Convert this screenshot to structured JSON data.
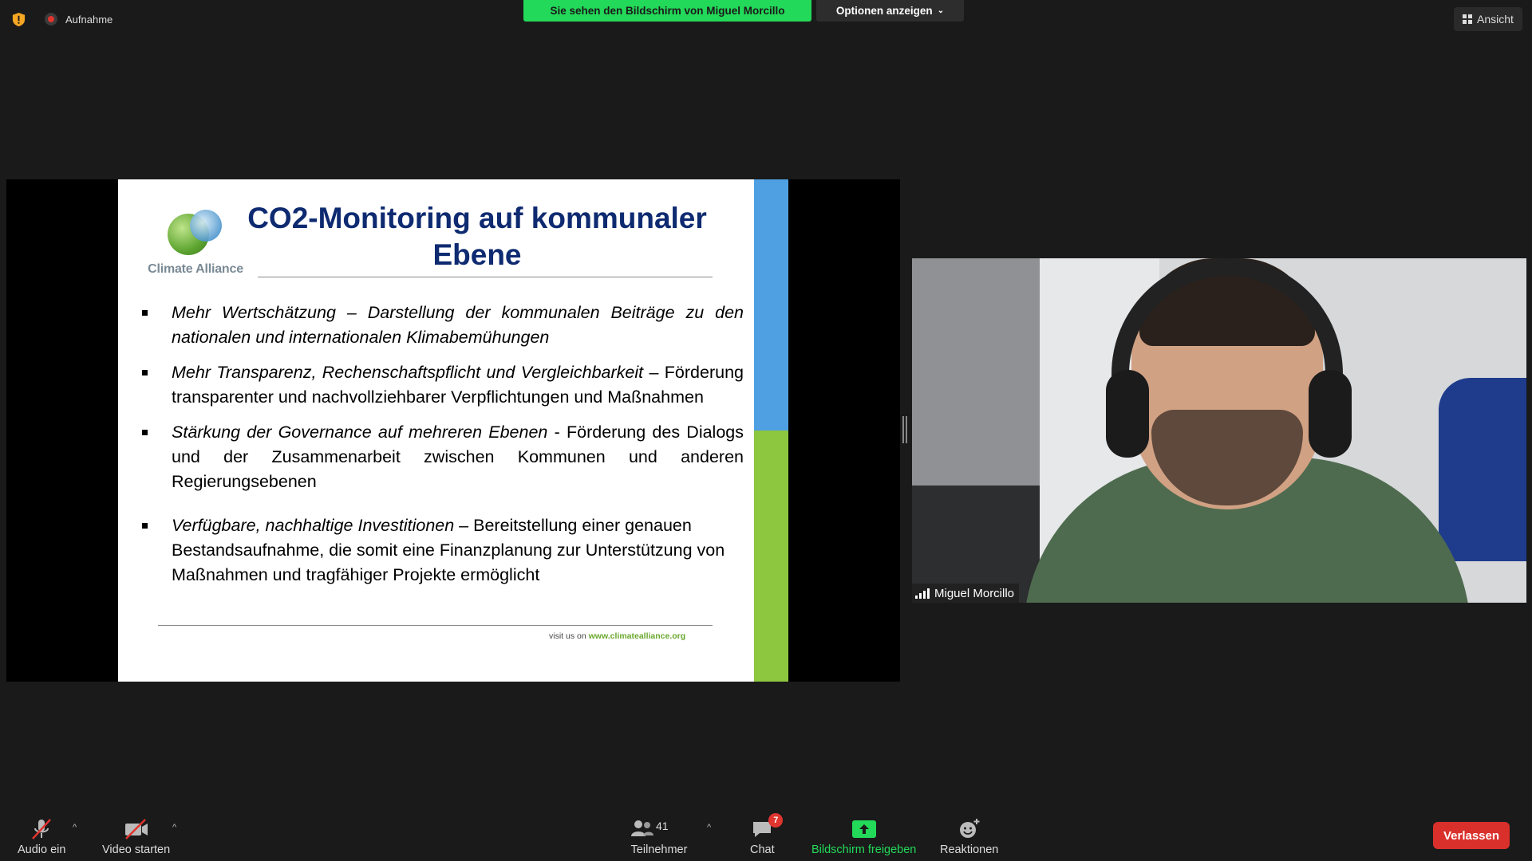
{
  "topbar": {
    "recording_label": "Aufnahme",
    "share_banner": "Sie sehen den Bildschirm von Miguel Morcillo",
    "options_label": "Optionen anzeigen",
    "view_label": "Ansicht"
  },
  "slide": {
    "logo_text": "Climate Alliance",
    "title": "CO2-Monitoring auf kommunaler Ebene",
    "bullets": [
      {
        "lead": "Mehr Wertschätzung – Darstellung der kommunalen Beiträge zu den nationalen und internationalen Klimabemühungen",
        "rest": ""
      },
      {
        "lead": "Mehr Transparenz, Rechenschaftspflicht und Vergleichbarkeit",
        "rest": " – Förderung transparenter und nachvollziehbarer Verpflichtungen und Maßnahmen"
      },
      {
        "lead": "Stärkung der Governance auf mehreren Ebenen",
        "rest": " - Förderung des Dialogs und der Zusammenarbeit zwischen Kommunen und anderen Regierungsebenen"
      },
      {
        "lead": "Verfügbare, nachhaltige Investitionen",
        "rest": " – Bereitstellung einer genauen Bestandsaufnahme, die somit eine Finanzplanung zur Unterstützung von Maßnahmen und tragfähiger Projekte ermöglicht"
      }
    ],
    "footer_prefix": "visit us on",
    "footer_url": "www.climatealliance.org"
  },
  "video": {
    "participant_name": "Miguel Morcillo"
  },
  "toolbar": {
    "audio_label": "Audio ein",
    "video_label": "Video starten",
    "participants_label": "Teilnehmer",
    "participants_count": "41",
    "chat_label": "Chat",
    "chat_badge": "7",
    "share_label": "Bildschirm freigeben",
    "reactions_label": "Reaktionen",
    "leave_label": "Verlassen"
  },
  "colors": {
    "share_green": "#23d959",
    "leave_red": "#d9302c",
    "slide_title": "#0e2a70",
    "bar_blue": "#4fa0e2",
    "bar_green": "#8dc63f"
  }
}
